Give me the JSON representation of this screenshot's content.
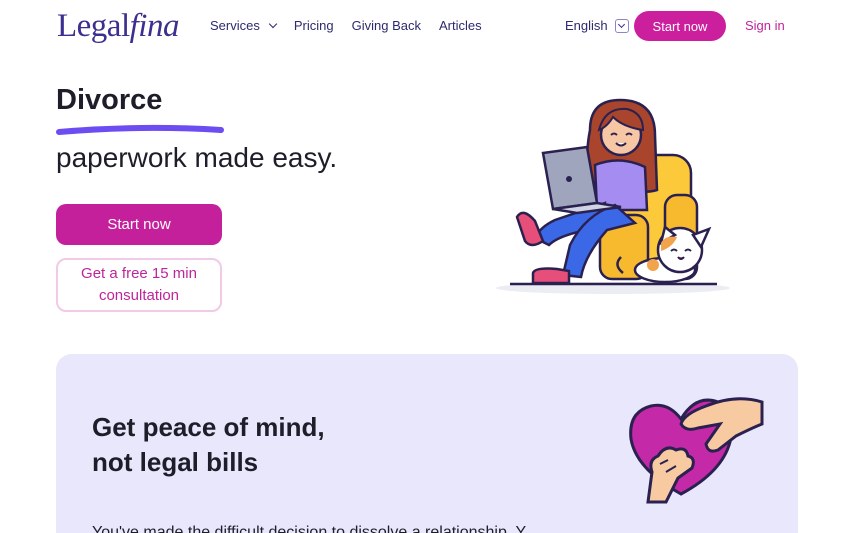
{
  "header": {
    "logo_regular": "Legal",
    "logo_italic": "fina",
    "nav": [
      "Services",
      "Pricing",
      "Giving Back",
      "Articles"
    ],
    "language": "English",
    "start_label": "Start now",
    "signin_label": "Sign in"
  },
  "hero": {
    "title": "Divorce",
    "subtitle": "paperwork made easy.",
    "primary_button": "Start now",
    "secondary_button": "Get a free 15 min consultation"
  },
  "panel": {
    "title_line1": "Get peace of mind,",
    "title_line2": "not legal bills",
    "body_partial": "You've made the difficult decision to dissolve a relationship. Y..."
  },
  "colors": {
    "brand": "#3b2f8f",
    "accent": "#cc1f9e",
    "panel_bg": "#e9e7fb",
    "underline": "#6c4df2"
  }
}
